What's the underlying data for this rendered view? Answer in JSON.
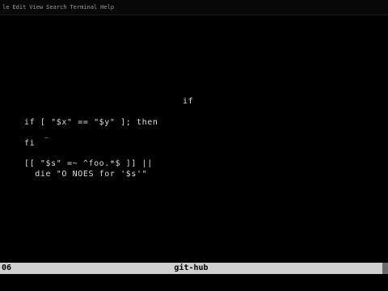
{
  "menubar": {
    "items": [
      {
        "id": "file",
        "label": "le"
      },
      {
        "id": "edit",
        "label": "Edit"
      },
      {
        "id": "view",
        "label": "View"
      },
      {
        "id": "search",
        "label": "Search"
      },
      {
        "id": "terminal",
        "label": "Terminal"
      },
      {
        "id": "help",
        "label": "Help"
      }
    ]
  },
  "terminal": {
    "lines": [
      {
        "id": "line-if-header",
        "text": "if"
      },
      {
        "id": "line-if-test",
        "text": "if [ \"$x\" == \"$y\" ]; then"
      },
      {
        "id": "line-tilde",
        "text": "_"
      },
      {
        "id": "line-fi",
        "text": "fi"
      },
      {
        "id": "line-regex",
        "text": "[[ \"$s\" =~ ^foo.*$ ]] ||"
      },
      {
        "id": "line-die",
        "text": "  die \"O NOES for '$s'\""
      }
    ]
  },
  "statusbar": {
    "left": "06",
    "center": "git-hub"
  }
}
